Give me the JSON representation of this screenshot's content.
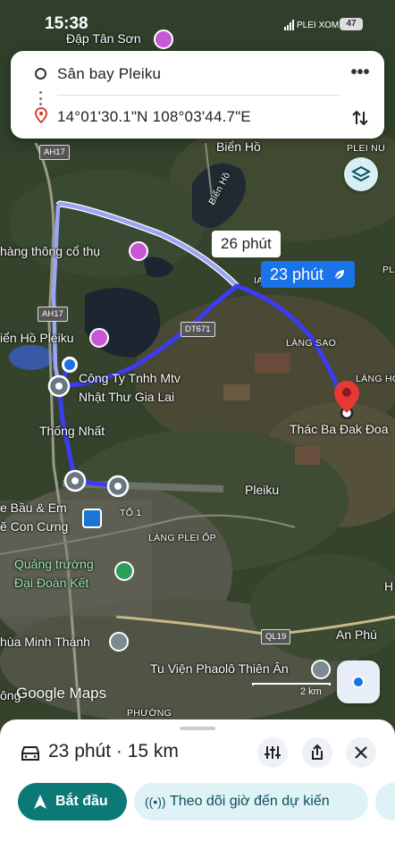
{
  "status_bar": {
    "time": "15:38",
    "carrier": "PLEI XOM",
    "battery": "47"
  },
  "route": {
    "origin": "Sân bay Pleiku",
    "destination": "14°01'30.1\"N 108°03'44.7\"E"
  },
  "map": {
    "labels": {
      "dap_tan_son": "Đập Tân Sơn",
      "bien_ho": "Biển Hồ",
      "bien_ho_road": "Biển Hồ",
      "plei_nu": "PLEI NU",
      "hang_thong": "hàng thông cổ thụ",
      "ah17_top": "AH17",
      "ah17_mid": "AH17",
      "ia": "IA",
      "pl_right": "PL",
      "dt671": "DT671",
      "bien_ho_pleiku": "iển Hồ Pleiku",
      "lang_sao": "LÀNG SAO",
      "lang_ho": "LÀNG HO",
      "cong_ty_1": "Công Ty Tnhh Mtv",
      "cong_ty_2": "Nhật Thư Gia Lai",
      "thac_ba": "Thác Ba Đak Đoa",
      "thong_nhat": "Thống Nhất",
      "pleiku": "Pleiku",
      "be_bau_1": "e Bầu & Em",
      "be_bau_2": "ẽ Con Cưng",
      "to1": "TỔ 1",
      "lang_plei_op": "LÀNG PLEI ỐP",
      "quang_truong_1": "Quảng trường",
      "quang_truong_2": "Đại Đoàn Kết",
      "ql19": "QL19",
      "an_phu": "An Phú",
      "chua_minh_thanh": "hùa Minh Thành",
      "tu_vien": "Tu Viện Phaolô Thiên Ân",
      "ong": "ông",
      "phuong": "PHƯỜNG",
      "h_edge": "H"
    },
    "alt_route_time": "26 phút",
    "main_route_time": "23 phút",
    "scale": "2 km",
    "logo": "Google Maps",
    "route_color": "#3c3cf0",
    "alt_route_color": "#9aa6f5"
  },
  "sheet": {
    "summary": "23 phút · 15 km",
    "start_label": "Bắt đầu",
    "track_label": "Theo dõi giờ đến dự kiến"
  }
}
